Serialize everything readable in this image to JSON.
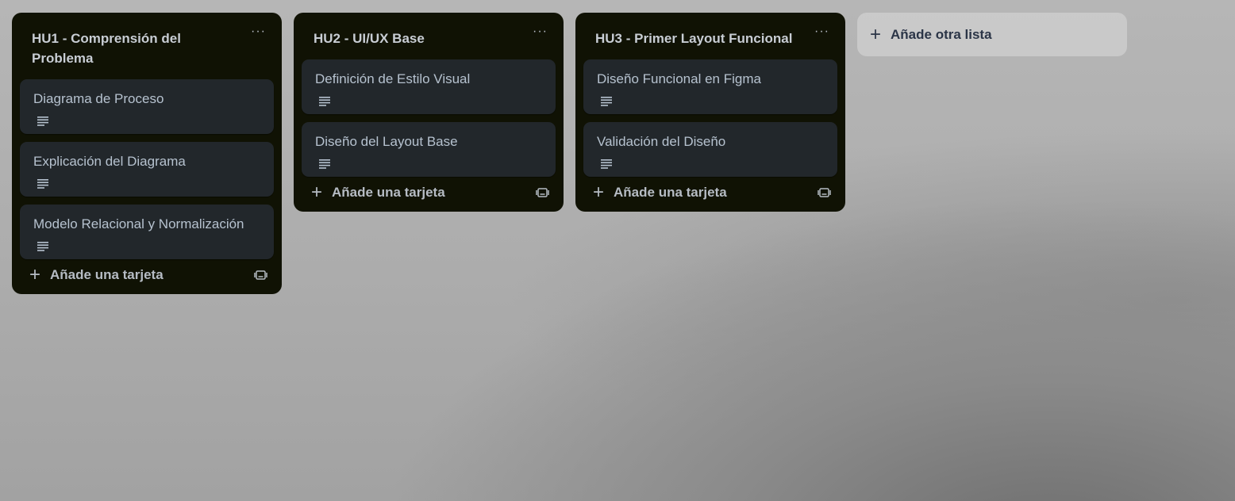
{
  "lists": [
    {
      "title": "HU1 - Comprensión del Problema",
      "menu_icon": "ellipsis-icon",
      "cards": [
        {
          "title": "Diagrama de Proceso",
          "icon": "description-icon"
        },
        {
          "title": "Explicación del Diagrama",
          "icon": "description-icon"
        },
        {
          "title": "Modelo Relacional y Normalización",
          "icon": "description-icon"
        }
      ],
      "add_card_label": "Añade una tarjeta"
    },
    {
      "title": "HU2 - UI/UX Base",
      "menu_icon": "ellipsis-icon",
      "cards": [
        {
          "title": "Definición de Estilo Visual",
          "icon": "description-icon"
        },
        {
          "title": "Diseño del Layout Base",
          "icon": "description-icon"
        }
      ],
      "add_card_label": "Añade una tarjeta"
    },
    {
      "title": "HU3 - Primer Layout Funcional",
      "menu_icon": "ellipsis-icon",
      "cards": [
        {
          "title": "Diseño Funcional en Figma",
          "icon": "description-icon"
        },
        {
          "title": "Validación del Diseño",
          "icon": "description-icon"
        }
      ],
      "add_card_label": "Añade una tarjeta"
    }
  ],
  "add_list_label": "Añade otra lista",
  "colors": {
    "list_bg": "#101204",
    "card_bg": "#22272b",
    "card_text": "#b6c2cf",
    "header_text": "#c8cdd4"
  }
}
